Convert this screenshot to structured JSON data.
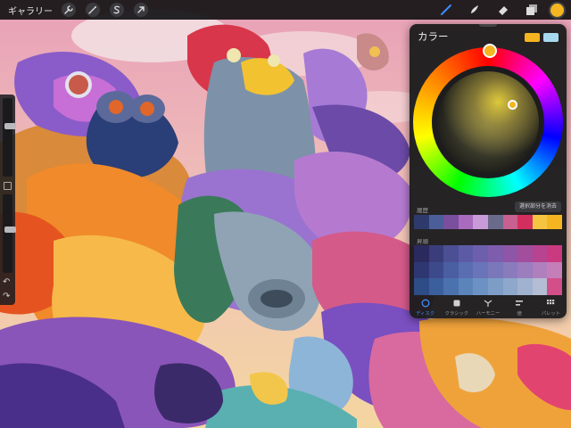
{
  "toolbar": {
    "gallery_label": "ギャラリー",
    "left_tools": [
      {
        "name": "actions",
        "icon": "wrench-icon"
      },
      {
        "name": "adjustments",
        "icon": "magic-wand-icon"
      },
      {
        "name": "selection",
        "icon": "selection-s-icon"
      },
      {
        "name": "transform",
        "icon": "arrow-cursor-icon"
      }
    ],
    "right_tools": [
      {
        "name": "brush",
        "icon": "brush-icon",
        "active": true
      },
      {
        "name": "smudge",
        "icon": "smudge-icon",
        "active": false
      },
      {
        "name": "eraser",
        "icon": "eraser-icon",
        "active": false
      },
      {
        "name": "layers",
        "icon": "layers-icon",
        "active": false
      }
    ],
    "current_color": "#f5b521"
  },
  "sidebar": {
    "brush_size_level": 0.35,
    "opacity_level": 0.45
  },
  "color_panel": {
    "title": "カラー",
    "primary_color": "#f5b521",
    "secondary_color": "#a7d9ee",
    "hue_color": "#f5b521",
    "history_label": "履歴",
    "clear_label": "選択部分を消去",
    "history_colors": [
      "#2e3a6b",
      "#4c5e9a",
      "#7a4f9e",
      "#a86bbd",
      "#c89ad8",
      "#6a6a8a",
      "#c86090",
      "#d32f5e",
      "#f5c542",
      "#f5b521"
    ],
    "palette_label": "昇順",
    "palette_colors": [
      "#2b2a5e",
      "#3a3d7a",
      "#4b4f93",
      "#5d5aa5",
      "#6e5fad",
      "#7e5cae",
      "#8f55a6",
      "#a24e9c",
      "#b84390",
      "#c93a80",
      "#2f3772",
      "#3c4a8c",
      "#4a5ea2",
      "#5a6db0",
      "#6a74b8",
      "#7a78bb",
      "#8a7bbd",
      "#9c7dbe",
      "#b07fbe",
      "#c47fb8",
      "#2e4c86",
      "#3b5f9c",
      "#4b72ae",
      "#5b84bb",
      "#6c92c3",
      "#7d9dc7",
      "#8ea8cb",
      "#a0b2cf",
      "#b3bdd3",
      "#d34f8a"
    ],
    "tabs": [
      {
        "label": "ディスク",
        "icon": "disc-icon",
        "active": true
      },
      {
        "label": "クラシック",
        "icon": "square-icon",
        "active": false
      },
      {
        "label": "ハーモニー",
        "icon": "harmony-icon",
        "active": false
      },
      {
        "label": "値",
        "icon": "sliders-icon",
        "active": false
      },
      {
        "label": "パレット",
        "icon": "grid-icon",
        "active": false
      }
    ]
  }
}
